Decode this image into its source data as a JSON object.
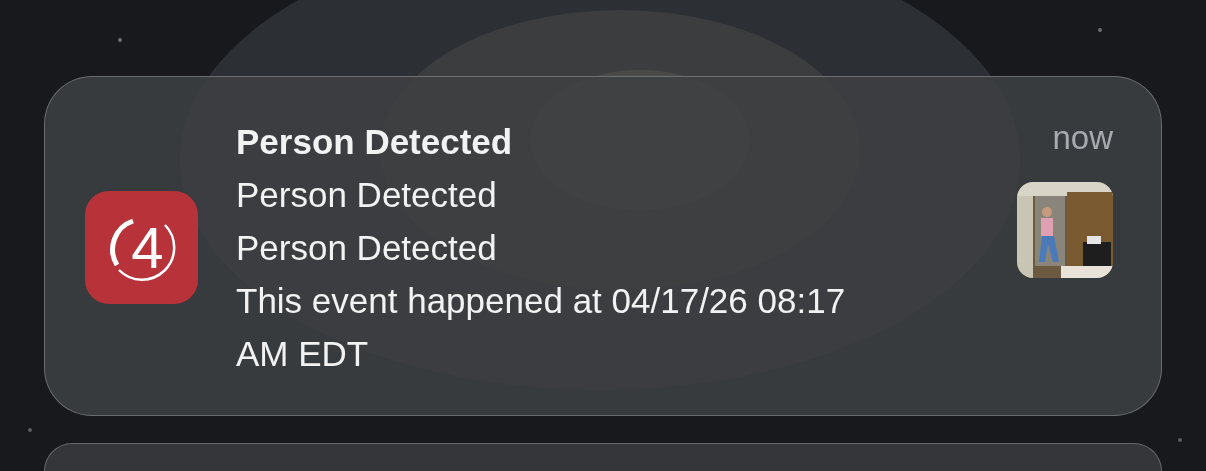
{
  "notification": {
    "app_icon": {
      "glyph": "4"
    },
    "title": "Person Detected",
    "lines": [
      "Person Detected",
      "Person Detected",
      "This event happened at 04/17/26 08:17 AM EDT"
    ],
    "time": "now"
  }
}
